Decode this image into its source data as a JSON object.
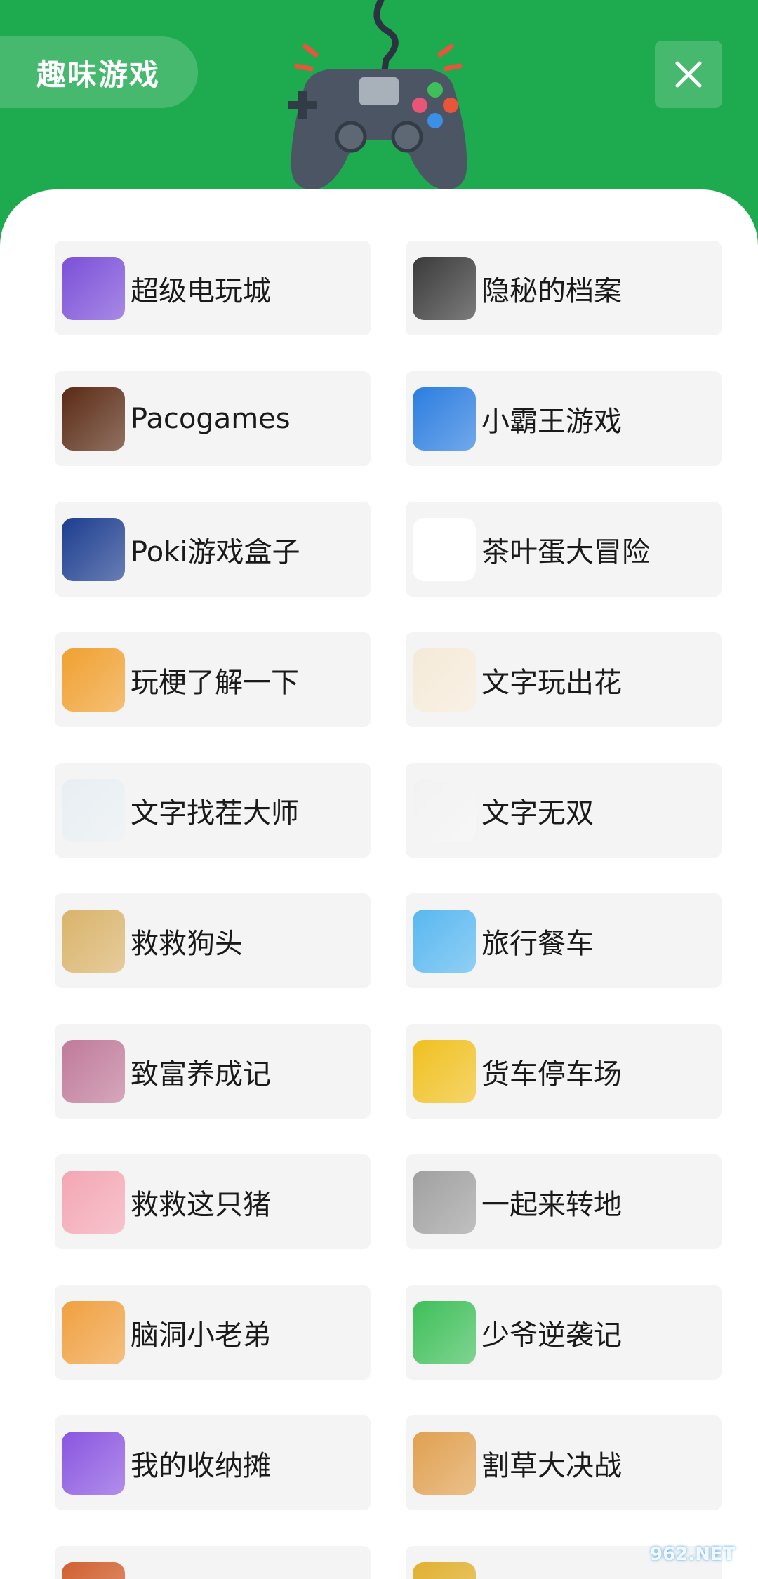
{
  "header": {
    "title": "趣味游戏",
    "close_icon": "close-icon",
    "decoration": "gamepad-icon"
  },
  "games": [
    {
      "label": "超级电玩城",
      "icon": "arcade-machine-icon",
      "color": "#7b4fd8"
    },
    {
      "label": "隐秘的档案",
      "icon": "secret-files-icon",
      "color": "#3a3a3a"
    },
    {
      "label": "Pacogames",
      "icon": "pacogames-icon",
      "color": "#5a2a14"
    },
    {
      "label": "小霸王游戏",
      "icon": "yikm-mushroom-icon",
      "color": "#2b7de0"
    },
    {
      "label": "Poki游戏盒子",
      "icon": "poki-logo-icon",
      "color": "#1c3d8f"
    },
    {
      "label": "茶叶蛋大冒险",
      "icon": "tea-egg-icon",
      "color": "#ffffff"
    },
    {
      "label": "玩梗了解一下",
      "icon": "meme-character-icon",
      "color": "#f0a030"
    },
    {
      "label": "文字玩出花",
      "icon": "text-flower-icon",
      "color": "#f5ead8"
    },
    {
      "label": "文字找茬大师",
      "icon": "text-spot-icon",
      "color": "#e8eef2"
    },
    {
      "label": "文字无双",
      "icon": "text-warrior-icon",
      "color": "#f2f2f2"
    },
    {
      "label": "救救狗头",
      "icon": "dog-head-icon",
      "color": "#d9b36a"
    },
    {
      "label": "旅行餐车",
      "icon": "food-truck-icon",
      "color": "#58b7f0"
    },
    {
      "label": "致富养成记",
      "icon": "rich-story-icon",
      "color": "#c07a9a"
    },
    {
      "label": "货车停车场",
      "icon": "truck-parking-icon",
      "color": "#f0c020"
    },
    {
      "label": "救救这只猪",
      "icon": "pig-icon",
      "color": "#f3a6b4"
    },
    {
      "label": "一起来转地",
      "icon": "drill-icon",
      "color": "#a0a0a0"
    },
    {
      "label": "脑洞小老弟",
      "icon": "brain-boy-icon",
      "color": "#f0a040"
    },
    {
      "label": "少爷逆袭记",
      "icon": "young-master-icon",
      "color": "#3fbf5a"
    },
    {
      "label": "我的收纳摊",
      "icon": "corgi-icon",
      "color": "#8a55e0"
    },
    {
      "label": "割草大决战",
      "icon": "tiger-icon",
      "color": "#e0a050"
    },
    {
      "label": "",
      "icon": "partial-icon",
      "color": "#d06030"
    },
    {
      "label": "",
      "icon": "partial-icon",
      "color": "#e0b030"
    }
  ],
  "watermark": "962.NET"
}
